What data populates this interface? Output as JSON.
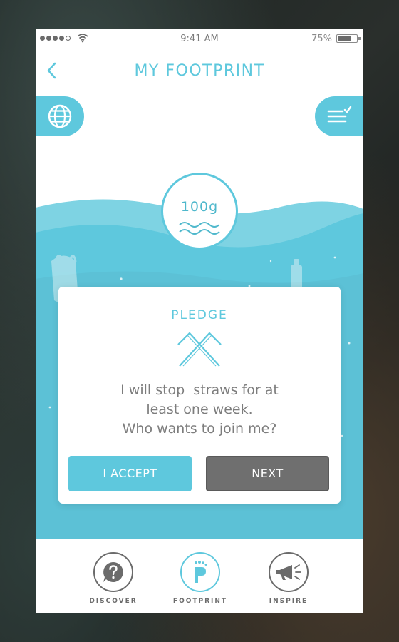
{
  "status_bar": {
    "time": "9:41 AM",
    "battery": "75%",
    "battery_level": 0.75
  },
  "nav": {
    "title": "MY FOOTPRINT",
    "back_icon": "chevron-left-icon"
  },
  "buttons": {
    "left_icon": "globe-icon",
    "right_icon": "checklist-icon"
  },
  "counter": {
    "value": "100g"
  },
  "pledge": {
    "title": "PLEDGE",
    "lines": [
      "I will stop  straws for at",
      "least one week.",
      "Who wants to join me?"
    ],
    "accept_label": "I ACCEPT",
    "next_label": "NEXT"
  },
  "tabs": [
    {
      "label": "DISCOVER",
      "icon": "question-bubble-icon"
    },
    {
      "label": "FOOTPRINT",
      "icon": "foot-icon",
      "active": true
    },
    {
      "label": "INSPIRE",
      "icon": "megaphone-icon"
    }
  ],
  "colors": {
    "accent": "#5ec8dd",
    "ocean": "#5bbdd3",
    "ocean_light": "#7ed3e3",
    "neutral": "#6f6f6f"
  }
}
